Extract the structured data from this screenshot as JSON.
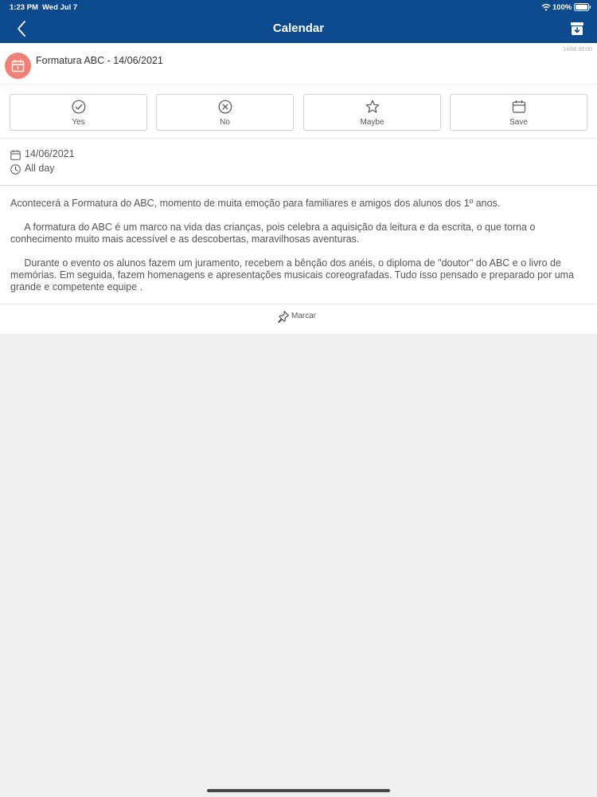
{
  "status_bar": {
    "time": "1:23 PM",
    "date": "Wed Jul 7",
    "battery": "100%"
  },
  "nav": {
    "title": "Calendar",
    "back_icon": "chevron-left-icon",
    "action_icon": "archive-box-icon"
  },
  "event": {
    "title": "Formatura ABC - 14/06/2021",
    "timestamp": "14/06 00:00",
    "icon": "calendar-icon",
    "icon_color": "#f08178"
  },
  "actions": [
    {
      "label": "Yes",
      "icon": "check-circle-icon"
    },
    {
      "label": "No",
      "icon": "x-circle-icon"
    },
    {
      "label": "Maybe",
      "icon": "star-icon"
    },
    {
      "label": "Save",
      "icon": "calendar-icon"
    }
  ],
  "info": {
    "date": "14/06/2021",
    "time": "All day"
  },
  "description": [
    "Acontecerá a Formatura do ABC, momento de muita emoção para familiares e amigos dos alunos dos 1º anos.",
    "     A formatura do ABC é um marco na vida das crianças, pois celebra a aquisição da leitura e da escrita, o que torna o conhecimento muito mais acessível e as descobertas, maravilhosas aventuras.",
    "     Durante o evento os alunos fazem um juramento, recebem a bênção dos anéis, o diploma de \"doutor\" do ABC e o livro de memórias. Em seguida, fazem homenagens e apresentações musicais coreografadas. Tudo isso pensado e preparado por uma grande e competente equipe ."
  ],
  "pin": {
    "label": "Marcar",
    "icon": "pin-icon"
  },
  "colors": {
    "header": "#0c4a8d",
    "background": "#efeef1"
  }
}
